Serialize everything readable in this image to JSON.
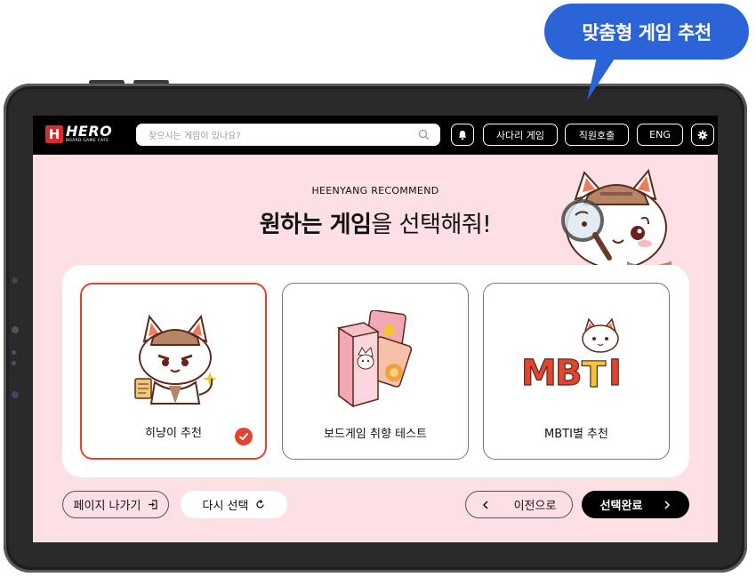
{
  "bubble": {
    "text": "맞춤형 게임 추천"
  },
  "header": {
    "logo_mark": "H",
    "logo_title": "HERO",
    "logo_sub": "BOARD GAME CAFE",
    "search_placeholder": "찾으시는 게임이 있나요?",
    "buttons": [
      "사다리 게임",
      "직원호출",
      "ENG"
    ],
    "icons": [
      "search-icon",
      "bell-icon",
      "gear-icon"
    ]
  },
  "main": {
    "subtitle": "HEENYANG RECOMMEND",
    "heading_bold": "원하는 게임",
    "heading_rest": "을 선택해줘!",
    "cards": [
      {
        "label": "히냥이 추천",
        "selected": true
      },
      {
        "label": "보드게임 취향 테스트",
        "selected": false
      },
      {
        "label": "MBTI별 추천",
        "selected": false
      }
    ],
    "mbti_art": [
      "M",
      "B",
      "T",
      "I"
    ]
  },
  "footer": {
    "exit_label": "페이지 나가기",
    "reset_label": "다시 선택",
    "prev_label": "이전으로",
    "done_label": "선택완료"
  },
  "colors": {
    "accent": "#e2452f",
    "bubble": "#2b64d6",
    "screen_bg": "#fde0e6",
    "topbar": "#000000"
  }
}
